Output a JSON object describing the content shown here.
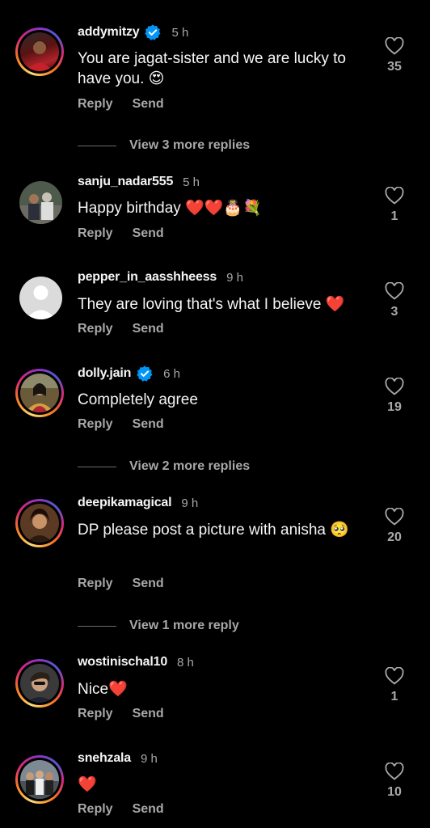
{
  "colors": {
    "background": "#000000",
    "primary_text": "#f5f5f5",
    "secondary_text": "#a8a8a8",
    "verified": "#0095f6",
    "heart": "#e0242c"
  },
  "actions": {
    "reply": "Reply",
    "send": "Send"
  },
  "comments": [
    {
      "username": "addymitzy",
      "verified": true,
      "time": "5 h",
      "text": "You are jagat-sister and we are lucky to have you. 😍",
      "likes": "35",
      "avatar": "story-ring",
      "more_replies": "View 3 more replies"
    },
    {
      "username": "sanju_nadar555",
      "verified": false,
      "time": "5 h",
      "text": "Happy birthday ❤️❤️🎂💐",
      "likes": "1",
      "avatar": "plain"
    },
    {
      "username": "pepper_in_aasshheess",
      "verified": false,
      "time": "9 h",
      "text": "They are loving that's what I believe ❤️",
      "likes": "3",
      "avatar": "default"
    },
    {
      "username": "dolly.jain",
      "verified": true,
      "time": "6 h",
      "text": "Completely agree",
      "likes": "19",
      "avatar": "story-ring",
      "more_replies": "View 2 more replies"
    },
    {
      "username": "deepikamagical",
      "verified": false,
      "time": "9 h",
      "text": "DP please post a picture with anisha 🥺",
      "likes": "20",
      "avatar": "story-ring",
      "more_replies": "View 1 more reply"
    },
    {
      "username": "wostinischal10",
      "verified": false,
      "time": "8 h",
      "text": "Nice❤️",
      "likes": "1",
      "avatar": "story-ring"
    },
    {
      "username": "snehzala",
      "verified": false,
      "time": "9 h",
      "text": "❤️",
      "likes": "10",
      "avatar": "story-ring"
    }
  ]
}
